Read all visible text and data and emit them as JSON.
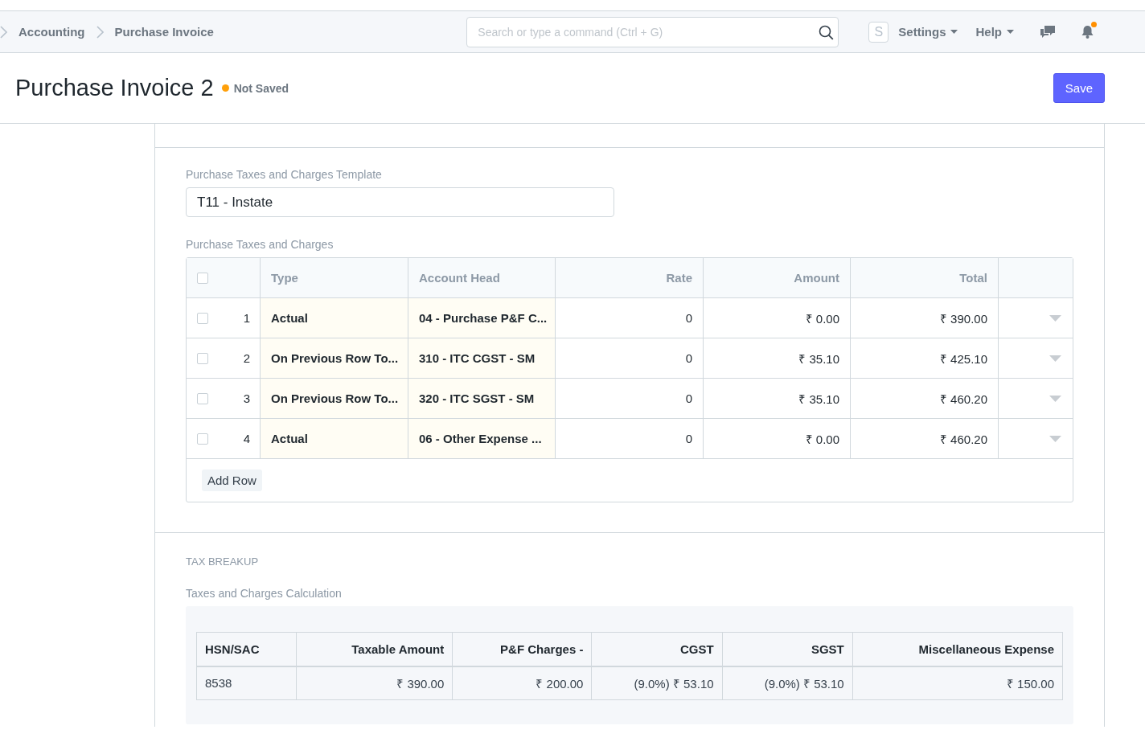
{
  "breadcrumbs": [
    "Accounting",
    "Purchase Invoice"
  ],
  "search": {
    "placeholder": "Search or type a command (Ctrl + G)"
  },
  "avatar": "S",
  "nav_menus": [
    "Settings",
    "Help"
  ],
  "notifications": {
    "unread": true
  },
  "page": {
    "title": "Purchase Invoice 2",
    "status": "Not Saved",
    "save_button": "Save"
  },
  "template_field": {
    "label": "Purchase Taxes and Charges Template",
    "value": "T11 - Instate"
  },
  "taxes_table": {
    "label": "Purchase Taxes and Charges",
    "all_checked": false,
    "columns": [
      "Type",
      "Account Head",
      "Rate",
      "Amount",
      "Total"
    ],
    "rows": [
      {
        "checked": false,
        "index": "1",
        "type": "Actual",
        "account_head": "04 - Purchase P&F C...",
        "rate": "0",
        "amount": "₹ 0.00",
        "total": "₹ 390.00"
      },
      {
        "checked": false,
        "index": "2",
        "type": "On Previous Row To...",
        "account_head": "310 - ITC CGST - SM",
        "rate": "0",
        "amount": "₹ 35.10",
        "total": "₹ 425.10"
      },
      {
        "checked": false,
        "index": "3",
        "type": "On Previous Row To...",
        "account_head": "320 - ITC SGST - SM",
        "rate": "0",
        "amount": "₹ 35.10",
        "total": "₹ 460.20"
      },
      {
        "checked": false,
        "index": "4",
        "type": "Actual",
        "account_head": "06 - Other Expense ...",
        "rate": "0",
        "amount": "₹ 0.00",
        "total": "₹ 460.20"
      }
    ],
    "add_row": "Add Row"
  },
  "tax_breakup": {
    "heading": "TAX BREAKUP",
    "label": "Taxes and Charges Calculation",
    "columns": [
      "HSN/SAC",
      "Taxable Amount",
      "P&F Charges -",
      "CGST",
      "SGST",
      "Miscellaneous Expense"
    ],
    "rows": [
      [
        "8538",
        "₹ 390.00",
        "₹ 200.00",
        "(9.0%) ₹ 53.10",
        "(9.0%) ₹ 53.10",
        "₹ 150.00"
      ]
    ]
  }
}
